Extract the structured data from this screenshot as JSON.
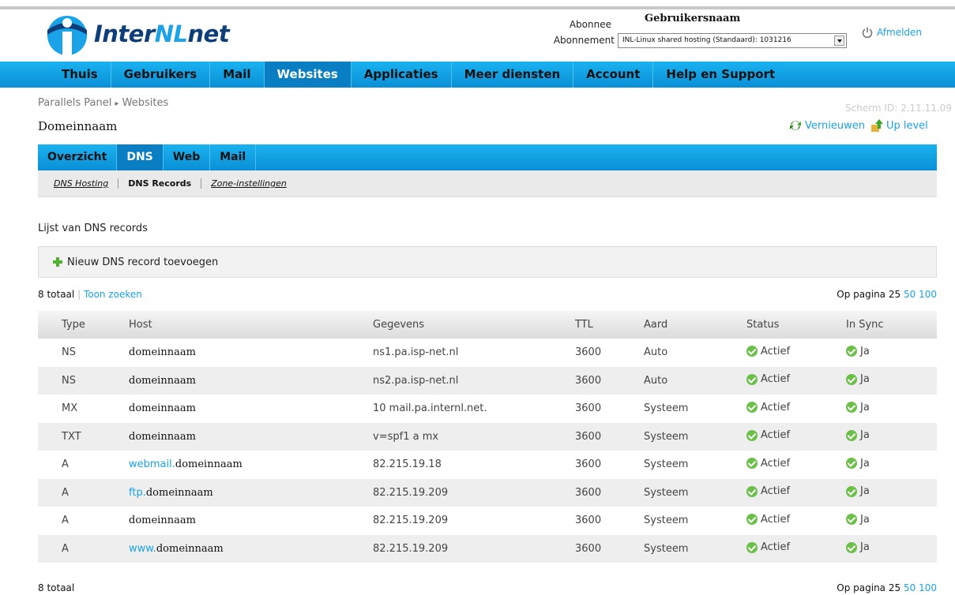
{
  "brand": {
    "name_prefix": "Inter",
    "name_highlight": "NL",
    "name_suffix": "net"
  },
  "header": {
    "subscriber_label": "Abonnee",
    "user_name": "Gebruikersnaam",
    "subscription_label": "Abonnement",
    "subscription_value": "INL-Linux shared hosting (Standaard): 1031216",
    "logout_label": "Afmelden"
  },
  "nav": {
    "items": [
      {
        "label": "Thuis",
        "active": false
      },
      {
        "label": "Gebruikers",
        "active": false
      },
      {
        "label": "Mail",
        "active": false
      },
      {
        "label": "Websites",
        "active": true
      },
      {
        "label": "Applicaties",
        "active": false
      },
      {
        "label": "Meer diensten",
        "active": false
      },
      {
        "label": "Account",
        "active": false
      },
      {
        "label": "Help en Support",
        "active": false
      }
    ]
  },
  "breadcrumb": {
    "root": "Parallels Panel",
    "sep": "▸",
    "current": "Websites"
  },
  "screen_id": "Scherm ID:  2.11.11.09",
  "page_title": "Domeinnaam",
  "actions": {
    "refresh": "Vernieuwen",
    "up": "Up level"
  },
  "tabs": [
    "Overzicht",
    "DNS",
    "Web",
    "Mail"
  ],
  "subtabs": [
    "DNS Hosting",
    "DNS Records",
    "Zone-instellingen"
  ],
  "list_title": "Lijst van DNS records",
  "add_record": "Nieuw DNS record toevoegen",
  "summary": {
    "total": "8 totaal",
    "sep": "|",
    "search": "Toon zoeken",
    "per_page": "Op pagina",
    "p25": "25",
    "p50": "50",
    "p100": "100"
  },
  "table": {
    "columns": [
      "Type",
      "Host",
      "Gegevens",
      "TTL",
      "Aard",
      "Status",
      "In Sync"
    ],
    "rows": [
      {
        "type": "NS",
        "host_prefix": "",
        "host": "domeinnaam",
        "data": "ns1.pa.isp-net.nl",
        "ttl": "3600",
        "aard": "Auto",
        "status": "Actief",
        "sync": "Ja"
      },
      {
        "type": "NS",
        "host_prefix": "",
        "host": "domeinnaam",
        "data": "ns2.pa.isp-net.nl",
        "ttl": "3600",
        "aard": "Auto",
        "status": "Actief",
        "sync": "Ja"
      },
      {
        "type": "MX",
        "host_prefix": "",
        "host": "domeinnaam",
        "data": "10 mail.pa.internl.net.",
        "ttl": "3600",
        "aard": "Systeem",
        "status": "Actief",
        "sync": "Ja"
      },
      {
        "type": "TXT",
        "host_prefix": "",
        "host": "domeinnaam",
        "data": "v=spf1 a mx",
        "ttl": "3600",
        "aard": "Systeem",
        "status": "Actief",
        "sync": "Ja"
      },
      {
        "type": "A",
        "host_prefix": "webmail.",
        "host": "domeinnaam",
        "data": "82.215.19.18",
        "ttl": "3600",
        "aard": "Systeem",
        "status": "Actief",
        "sync": "Ja"
      },
      {
        "type": "A",
        "host_prefix": "ftp.",
        "host": "domeinnaam",
        "data": "82.215.19.209",
        "ttl": "3600",
        "aard": "Systeem",
        "status": "Actief",
        "sync": "Ja"
      },
      {
        "type": "A",
        "host_prefix": "",
        "host": "domeinnaam",
        "data": "82.215.19.209",
        "ttl": "3600",
        "aard": "Systeem",
        "status": "Actief",
        "sync": "Ja"
      },
      {
        "type": "A",
        "host_prefix": "www.",
        "host": "domeinnaam",
        "data": "82.215.19.209",
        "ttl": "3600",
        "aard": "Systeem",
        "status": "Actief",
        "sync": "Ja"
      }
    ]
  },
  "colors": {
    "accent": "#1aa3e8",
    "nav_active": "#0a7ec3",
    "ok_green": "#6cc04a",
    "brand_dark": "#0d3e7a"
  }
}
